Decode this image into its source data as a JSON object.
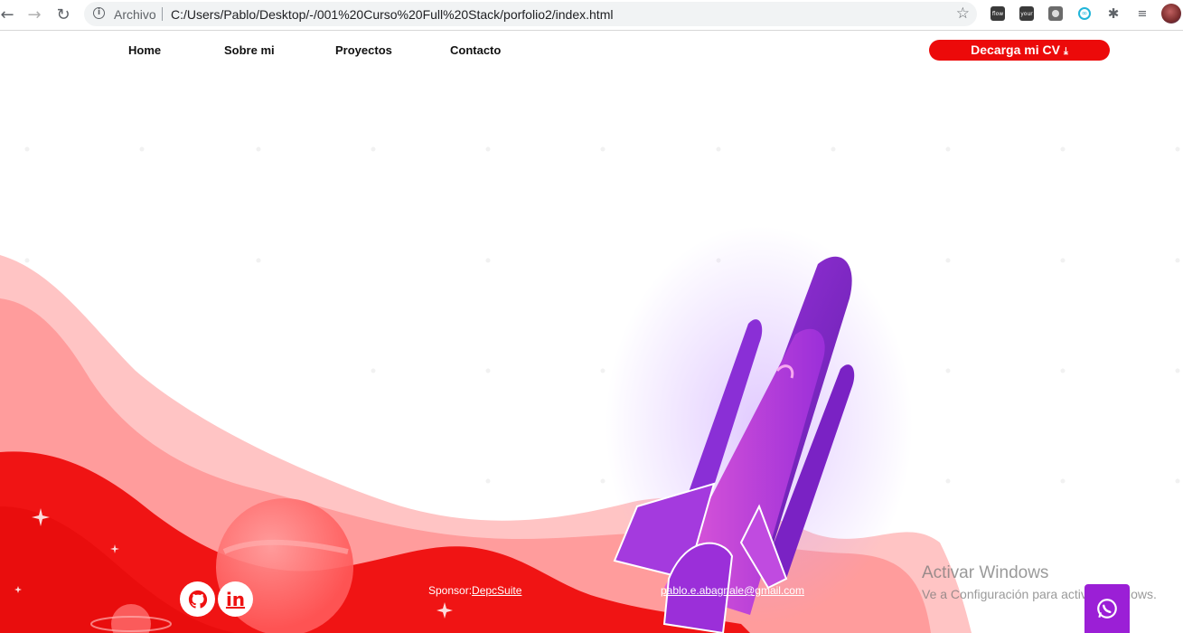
{
  "browser": {
    "back_icon": "arrow-left-icon",
    "forward_icon": "arrow-right-icon",
    "reload_icon": "reload-icon",
    "site_info_label": "Archivo",
    "url": "C:/Users/Pablo/Desktop/-/001%20Curso%20Full%20Stack/porfolio2/index.html",
    "extensions": [
      "flow-extension-icon",
      "your-extension-icon",
      "grey-extension-icon",
      "infinity-extension-icon",
      "puzzle-extensions-icon",
      "reading-list-icon"
    ]
  },
  "nav": {
    "items": [
      "Home",
      "Sobre mi",
      "Proyectos",
      "Contacto"
    ],
    "cv_button": "Decarga mi CV"
  },
  "footer": {
    "sponsor_label": "Sponsor:",
    "sponsor_link": "DepcSuite",
    "email": "pablo.e.abagnale@gmail.com"
  },
  "windows_watermark": {
    "title": "Activar Windows",
    "subtitle": "Ve a Configuración para activar Windows."
  },
  "colors": {
    "accent": "#ec0a0a",
    "rocket": "#8a2be2",
    "whatsapp_button": "#9b1fd6"
  }
}
